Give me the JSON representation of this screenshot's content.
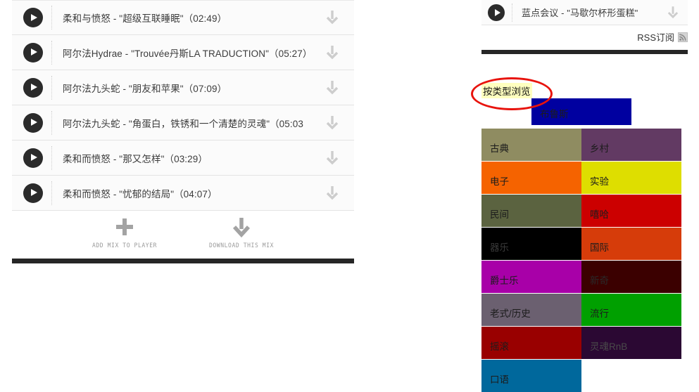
{
  "playlist": {
    "tracks": [
      {
        "title": "柔和与愤怒 - \"超级互联睡眠\"（02:49）",
        "play_icon": "play-icon",
        "download_icon": "download-arrow-icon"
      },
      {
        "title": "阿尔法Hydrae - \"Trouvée丹斯LA TRADUCTION\"（05:27）",
        "play_icon": "play-icon",
        "download_icon": "download-arrow-icon"
      },
      {
        "title": "阿尔法九头蛇 - \"朋友和苹果\"（07:09）",
        "play_icon": "play-icon",
        "download_icon": "download-arrow-icon"
      },
      {
        "title": "阿尔法九头蛇 - \"角蛋白，铁锈和一个清楚的灵魂\"（05:03",
        "play_icon": "play-icon",
        "download_icon": "download-arrow-icon"
      },
      {
        "title": "柔和而愤怒 - \"那又怎样\"（03:29）",
        "play_icon": "play-icon",
        "download_icon": "download-arrow-icon"
      },
      {
        "title": "柔和而愤怒 - \"忧郁的结局\"（04:07）",
        "play_icon": "play-icon",
        "download_icon": "download-arrow-icon"
      }
    ],
    "actions": [
      {
        "label": "ADD MIX TO PLAYER",
        "icon": "plus-icon"
      },
      {
        "label": "DOWNLOAD THIS MIX",
        "icon": "download-arrow-icon"
      }
    ]
  },
  "right_column": {
    "track": {
      "title": "蓝点会议 - \"马歇尔杯形蛋糕\"",
      "play_icon": "play-icon",
      "download_icon": "download-arrow-icon"
    },
    "rss": {
      "label": "RSS订阅",
      "icon": "rss-icon"
    },
    "browse_heading": "按类型浏览",
    "annotation": {
      "shape": "ellipse",
      "color": "#e8130d"
    },
    "genres": [
      {
        "label": "布鲁斯",
        "color": "#0000A0",
        "text_color": "#1c1c1c",
        "position": "offset-top"
      },
      {
        "label": "古典",
        "color": "#8F8C61",
        "text_color": "#1c1c1c"
      },
      {
        "label": "乡村",
        "color": "#623A63",
        "text_color": "#1c1c1c"
      },
      {
        "label": "电子",
        "color": "#F56300",
        "text_color": "#1c1c1c"
      },
      {
        "label": "实验",
        "color": "#DEDE00",
        "text_color": "#1c1c1c"
      },
      {
        "label": "民间",
        "color": "#5B6340",
        "text_color": "#1c1c1c"
      },
      {
        "label": "嘻哈",
        "color": "#CC0000",
        "text_color": "#1c1c1c"
      },
      {
        "label": "器乐",
        "color": "#000000",
        "text_color": "#3a3a3a"
      },
      {
        "label": "国际",
        "color": "#D63C0A",
        "text_color": "#1c1c1c"
      },
      {
        "label": "爵士乐",
        "color": "#A800A8",
        "text_color": "#1c1c1c"
      },
      {
        "label": "新奇",
        "color": "#3B0000",
        "text_color": "#2a2a2a"
      },
      {
        "label": "老式/历史",
        "color": "#6B6070",
        "text_color": "#1c1c1c"
      },
      {
        "label": "流行",
        "color": "#00A000",
        "text_color": "#1c1c1c"
      },
      {
        "label": "摇滚",
        "color": "#990000",
        "text_color": "#1c1c1c"
      },
      {
        "label": "灵魂RnB",
        "color": "#2B0833",
        "text_color": "#4a4a4a"
      },
      {
        "label": "口语",
        "color": "#00689C",
        "text_color": "#1c1c1c"
      }
    ]
  }
}
